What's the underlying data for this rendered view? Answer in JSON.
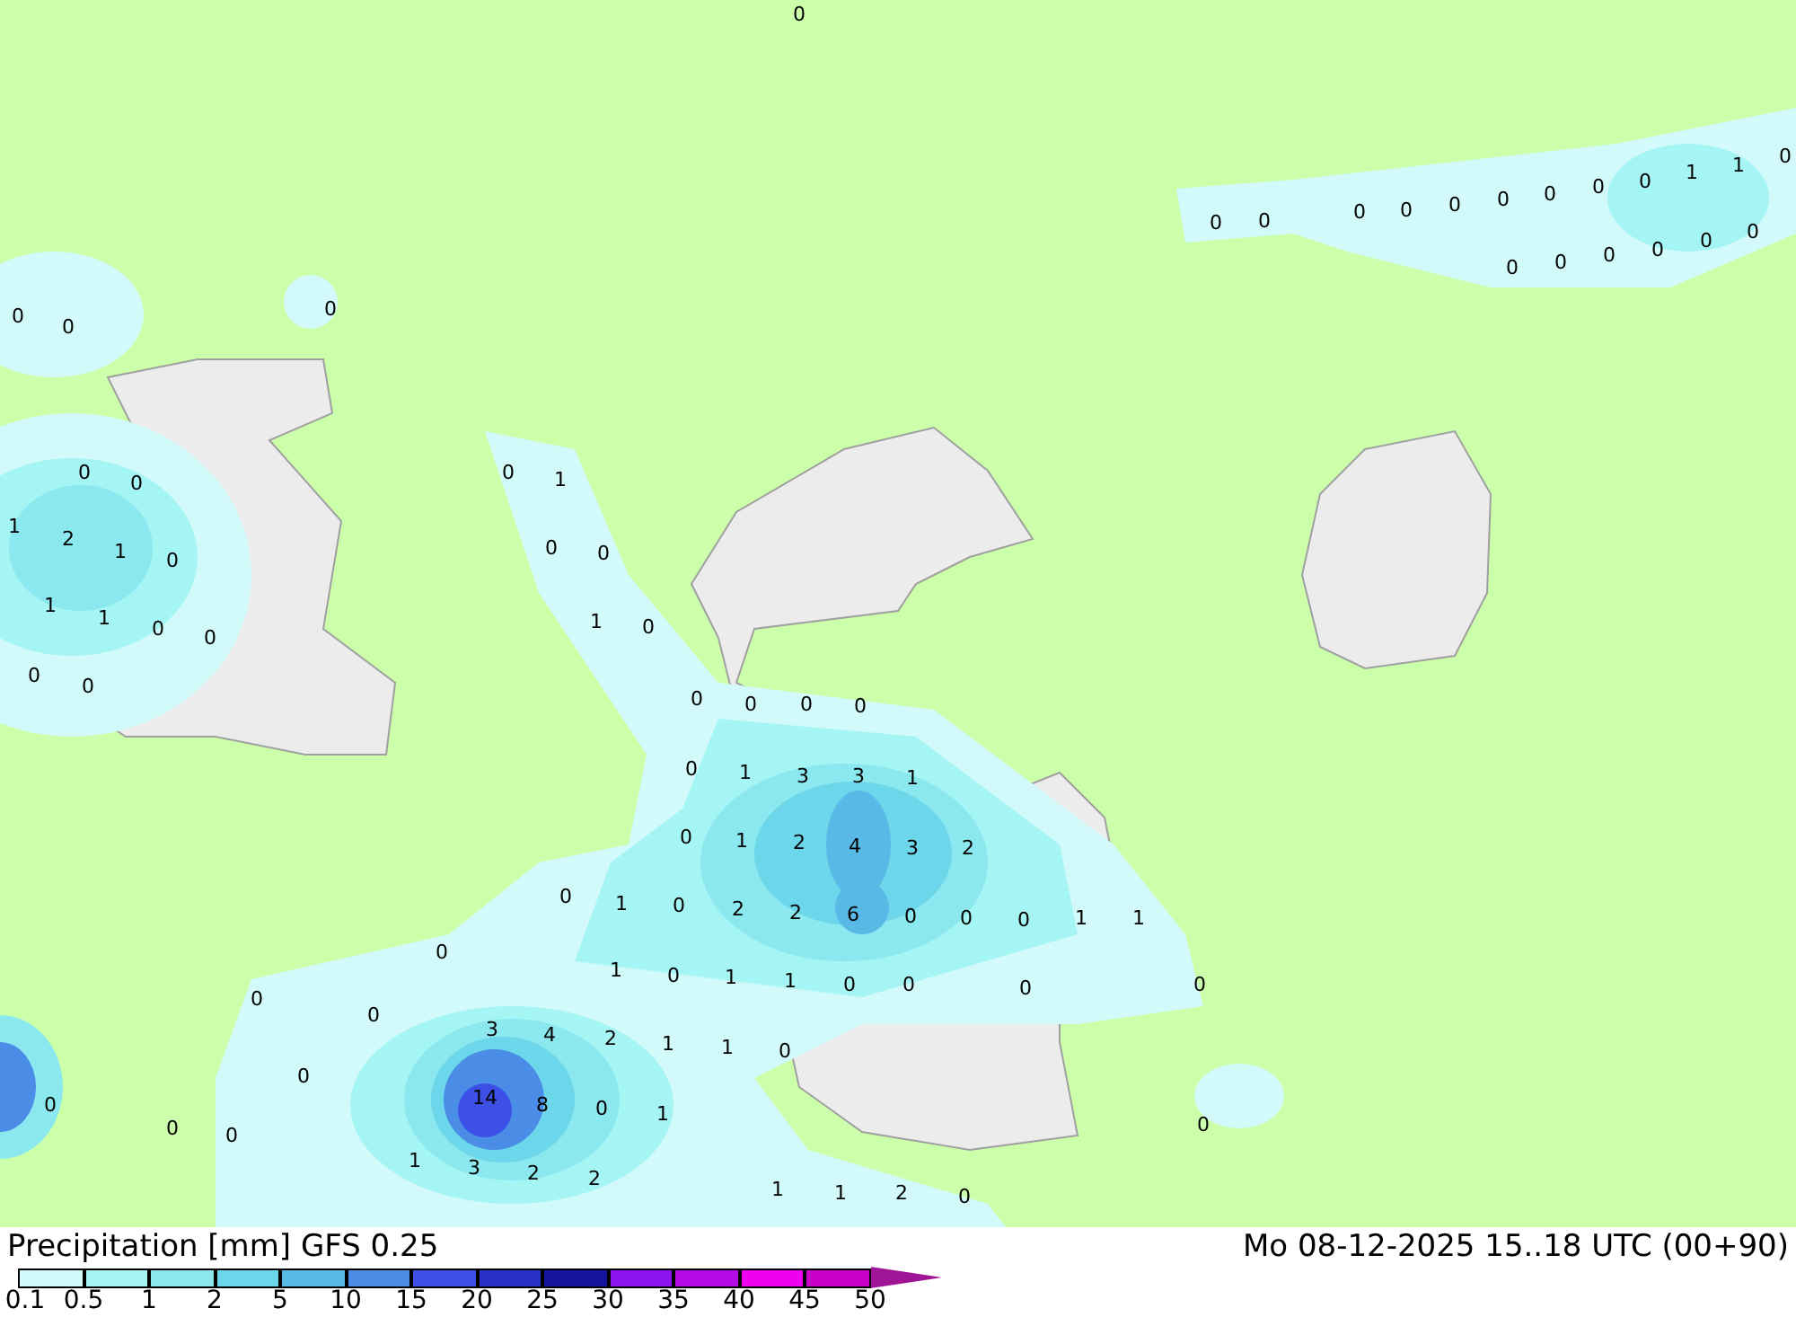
{
  "map": {
    "values": [
      "0",
      "0",
      "0",
      "0",
      "0",
      "0",
      "0",
      "0",
      "0",
      "0",
      "1",
      "1",
      "0",
      "0",
      "0",
      "0",
      "0",
      "0",
      "0",
      "0",
      "0",
      "0",
      "0",
      "0",
      "1",
      "2",
      "1",
      "0",
      "1",
      "1",
      "0",
      "0",
      "0",
      "0",
      "0",
      "1",
      "0",
      "0",
      "1",
      "0",
      "0",
      "0",
      "0",
      "0",
      "0",
      "1",
      "3",
      "3",
      "1",
      "0",
      "1",
      "2",
      "4",
      "3",
      "2",
      "0",
      "1",
      "0",
      "2",
      "2",
      "6",
      "0",
      "0",
      "0",
      "1",
      "1",
      "1",
      "0",
      "1",
      "1",
      "0",
      "0",
      "0",
      "0",
      "0",
      "0",
      "0",
      "3",
      "4",
      "2",
      "1",
      "1",
      "0",
      "0",
      "0",
      "14",
      "8",
      "0",
      "1",
      "0",
      "0",
      "1",
      "3",
      "2",
      "2",
      "1",
      "1",
      "2",
      "0",
      "0"
    ]
  },
  "title": {
    "left": "Precipitation [mm] GFS 0.25",
    "right": "Mo 08-12-2025 15..18 UTC (00+90)"
  },
  "legend": {
    "bins": [
      {
        "color": "#d2fafa"
      },
      {
        "color": "#a5f5f5"
      },
      {
        "color": "#8ae8ee"
      },
      {
        "color": "#6cd6ea"
      },
      {
        "color": "#58b8e6"
      },
      {
        "color": "#4a8ce6"
      },
      {
        "color": "#3c50e6"
      },
      {
        "color": "#2832c8"
      },
      {
        "color": "#14149e"
      },
      {
        "color": "#8c14f0"
      },
      {
        "color": "#b40ae6"
      },
      {
        "color": "#f000f0"
      },
      {
        "color": "#c800c8"
      },
      {
        "kind": "arrow",
        "color": "#a01496"
      }
    ],
    "labels": [
      "0.1",
      "0.5",
      "1",
      "2",
      "5",
      "10",
      "15",
      "20",
      "25",
      "30",
      "35",
      "40",
      "45",
      "50"
    ]
  }
}
